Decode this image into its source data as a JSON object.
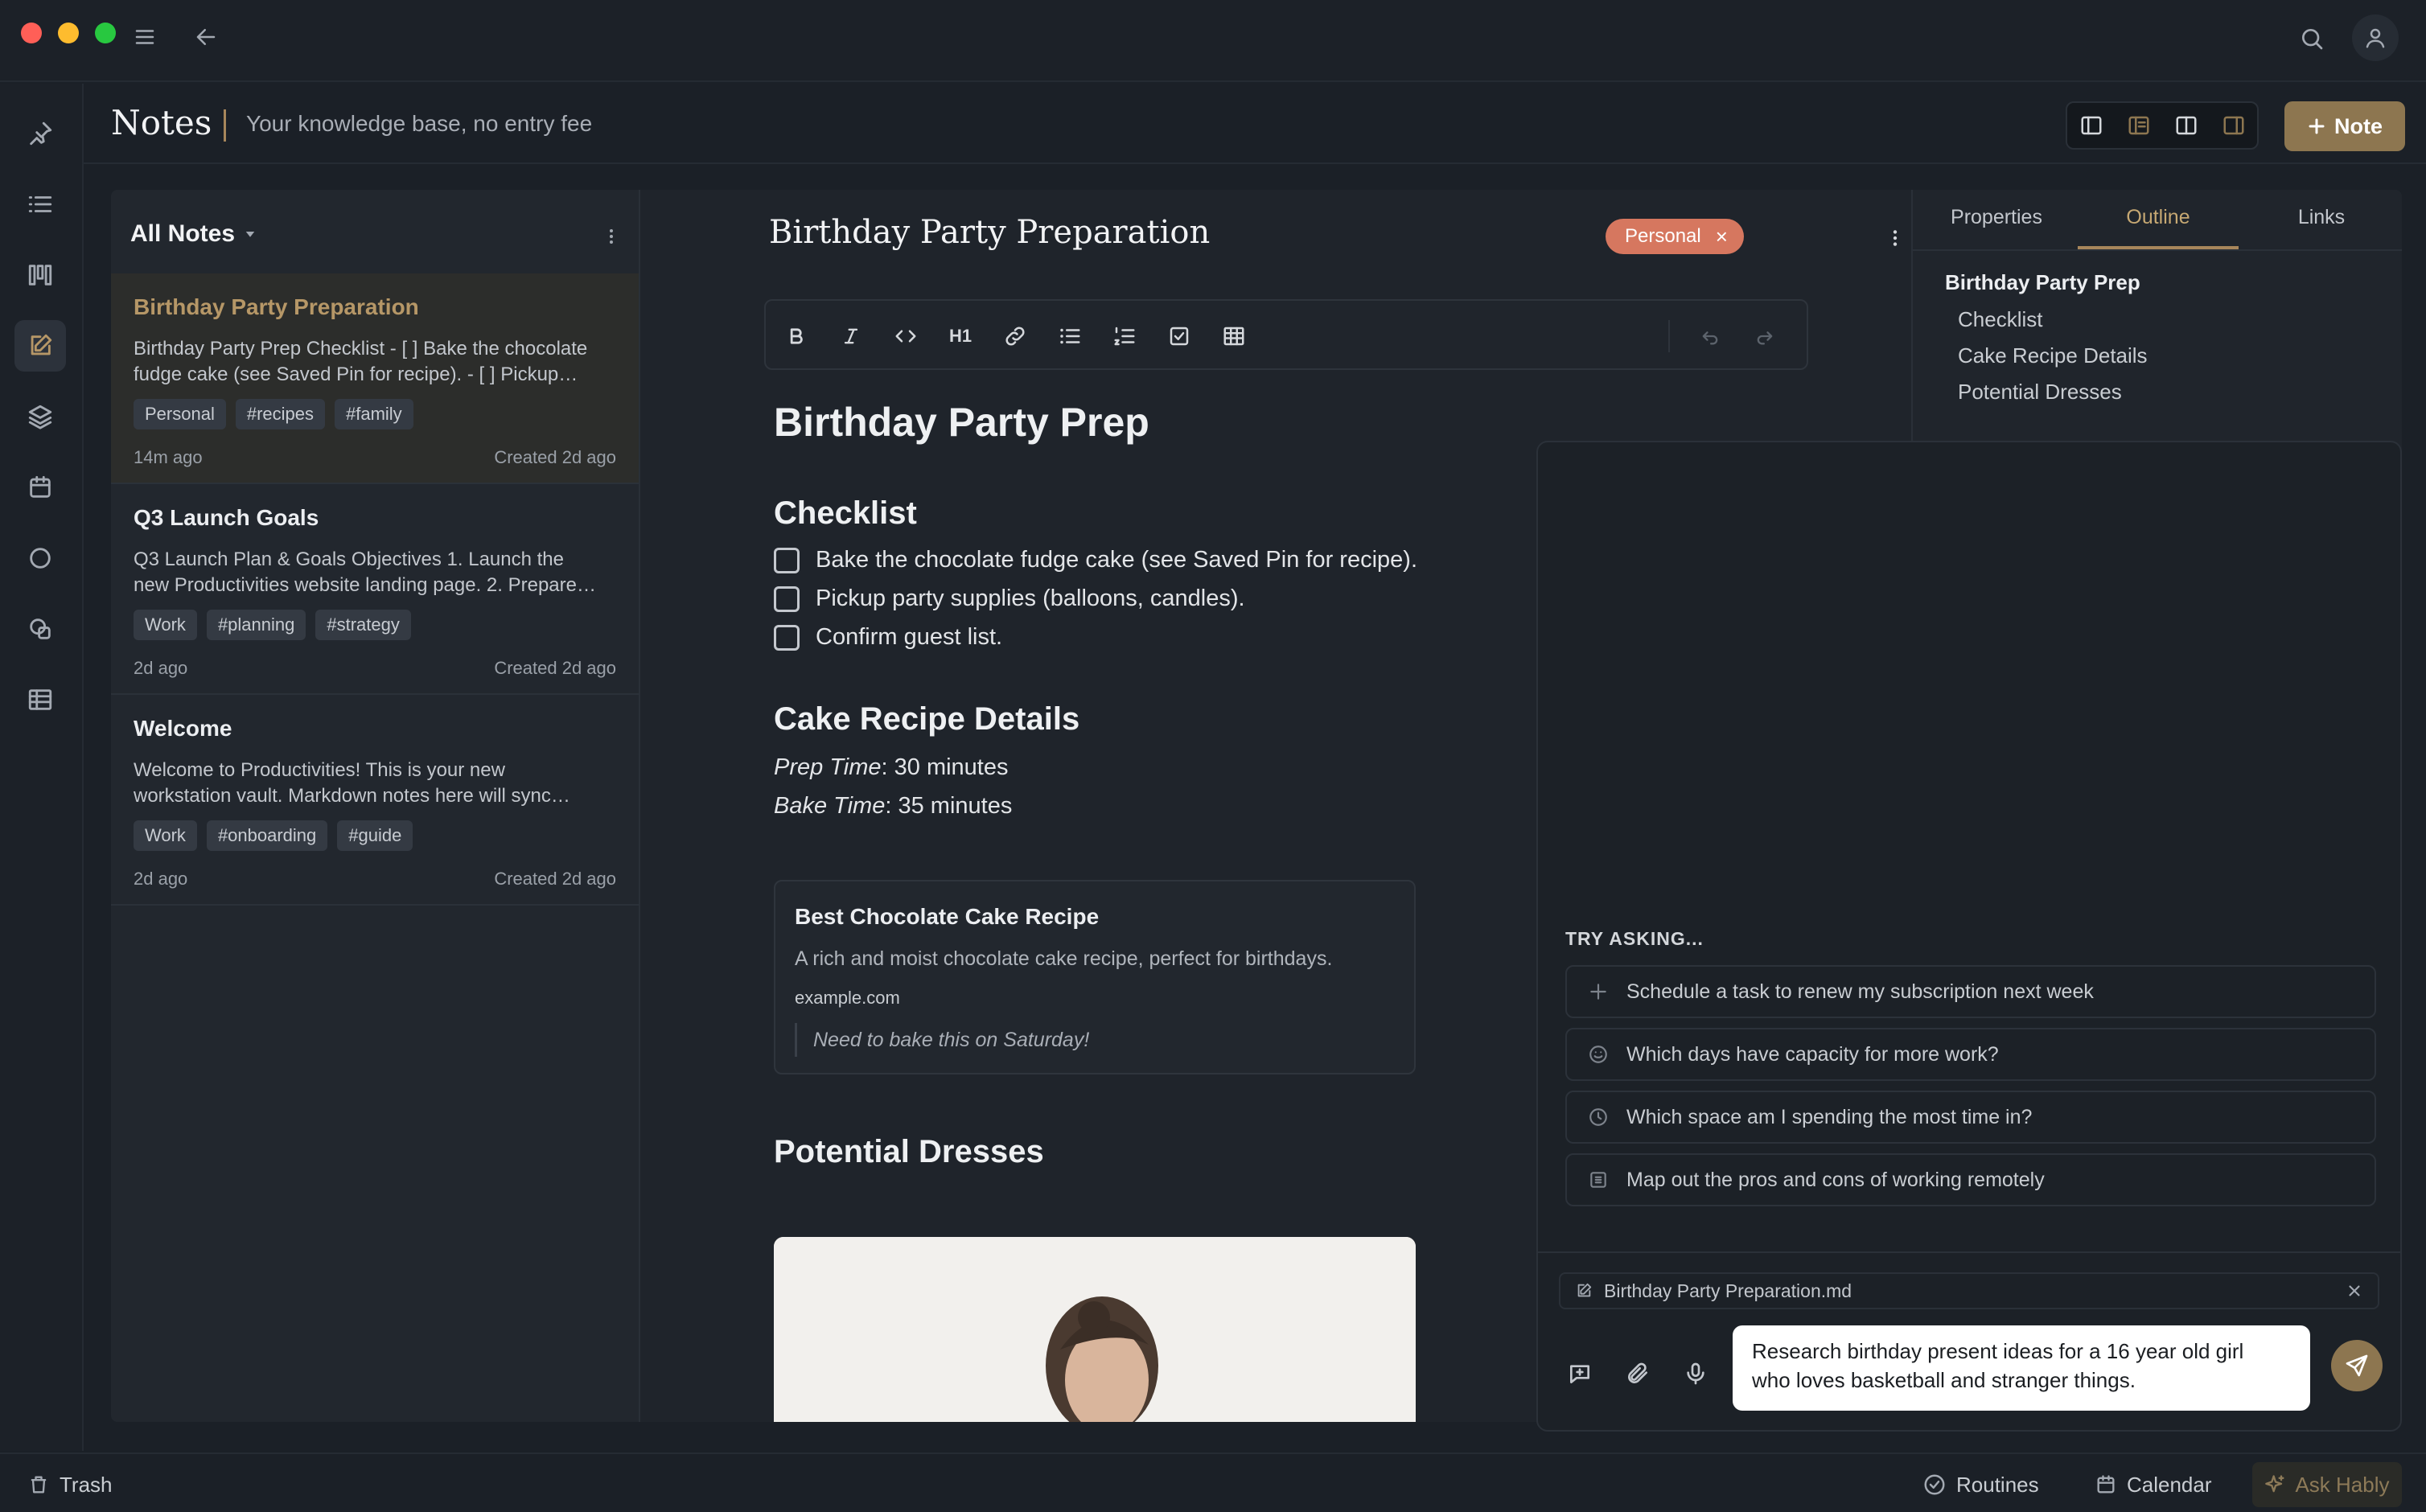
{
  "window": {
    "colors": {
      "close": "#ff5f57",
      "minimize": "#febc2e",
      "zoom": "#28c840"
    }
  },
  "header": {
    "title": "Notes",
    "subtitle": "Your knowledge base, no entry fee",
    "new_note_label": "Note"
  },
  "rail": {
    "items": [
      "pin-icon",
      "list-icon",
      "kanban-icon",
      "notes-edit-icon",
      "layers-icon",
      "calendar-icon",
      "circle-icon",
      "shapes-icon",
      "table-icon"
    ],
    "active": "notes-edit-icon"
  },
  "notes_list": {
    "filter_label": "All Notes",
    "notes": [
      {
        "title": "Birthday Party Preparation",
        "snippet_line1": "Birthday Party Prep Checklist - [ ] Bake the chocolate",
        "snippet_line2": "fudge cake (see Saved Pin for recipe). - [ ] Pickup…",
        "tags": [
          "Personal",
          "#recipes",
          "#family"
        ],
        "age": "14m ago",
        "created": "Created 2d ago"
      },
      {
        "title": "Q3 Launch Goals",
        "snippet_line1": "Q3 Launch Plan & Goals Objectives 1. Launch the",
        "snippet_line2": "new Productivities website landing page. 2. Prepare…",
        "tags": [
          "Work",
          "#planning",
          "#strategy"
        ],
        "age": "2d ago",
        "created": "Created 2d ago"
      },
      {
        "title": "Welcome",
        "snippet_line1": "Welcome to Productivities! This is your new",
        "snippet_line2": "workstation vault. Markdown notes here will sync…",
        "tags": [
          "Work",
          "#onboarding",
          "#guide"
        ],
        "age": "2d ago",
        "created": "Created 2d ago"
      }
    ]
  },
  "editor": {
    "doc_title": "Birthday Party Preparation",
    "tag": "Personal",
    "tag_close": "×",
    "heading": "Birthday Party Prep",
    "checklist_heading": "Checklist",
    "checklist": [
      "Bake the chocolate fudge cake (see Saved Pin for recipe).",
      "Pickup party supplies (balloons, candles).",
      "Confirm guest list."
    ],
    "recipe_heading": "Cake Recipe Details",
    "prep_label": "Prep Time",
    "prep_value": ": 30 minutes",
    "bake_label": "Bake Time",
    "bake_value": ": 35 minutes",
    "pin": {
      "title": "Best Chocolate Cake Recipe",
      "description": "A rich and moist chocolate cake recipe, perfect for birthdays.",
      "url": "example.com",
      "note": "Need to bake this on Saturday!"
    },
    "dresses_heading": "Potential Dresses",
    "toolbar_h1": "H1"
  },
  "right_panel": {
    "tabs": [
      "Properties",
      "Outline",
      "Links"
    ],
    "active_tab": "Outline",
    "outline_title": "Birthday Party Prep",
    "outline_items": [
      "Checklist",
      "Cake Recipe Details",
      "Potential Dresses"
    ]
  },
  "chat": {
    "try_label": "TRY ASKING...",
    "suggestions": [
      {
        "icon": "plus-icon",
        "text": "Schedule a task to renew my subscription next week"
      },
      {
        "icon": "smile-icon",
        "text": "Which days have capacity for more work?"
      },
      {
        "icon": "clock-icon",
        "text": "Which space am I spending the most time in?"
      },
      {
        "icon": "grid-icon",
        "text": "Map out the pros and cons of working remotely"
      }
    ],
    "attached_file": "Birthday Party Preparation.md",
    "input_line1": "Research birthday present ideas for a 16 year old girl",
    "input_line2": "who loves basketball and stranger things."
  },
  "statusbar": {
    "trash": "Trash",
    "routines": "Routines",
    "calendar": "Calendar",
    "ask": "Ask Hably"
  },
  "colors": {
    "accent": "#8d7650",
    "tag_personal": "#d6775f",
    "active_note_title": "#b69767"
  }
}
